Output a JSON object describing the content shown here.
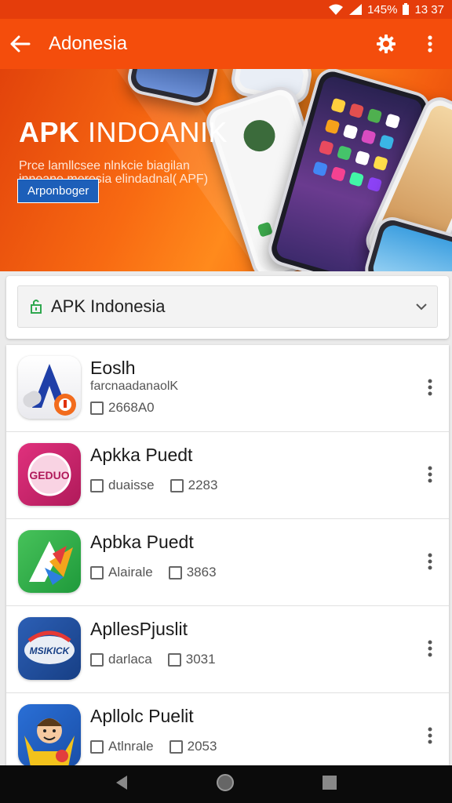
{
  "status_bar": {
    "battery": "145%",
    "time": "13 37"
  },
  "app_bar": {
    "title": "Adonesia"
  },
  "banner": {
    "title_bold": "APK ",
    "title_thin": "INDOANIK",
    "subtitle": "Prce lamllcsee nlnkcie biagilan inneane merosia elindadnal( APF)",
    "button": "Arponboger"
  },
  "selector": {
    "label": "APK Indonesia"
  },
  "apps": [
    {
      "name": "Eoslh",
      "sub": "farcnaadanaolK",
      "meta1": "2668A0",
      "meta2": ""
    },
    {
      "name": "Apkka Puedt",
      "sub": "",
      "meta1": "duaisse",
      "meta2": "2283"
    },
    {
      "name": "Apbka Puedt",
      "sub": "",
      "meta1": "Alairale",
      "meta2": "3863"
    },
    {
      "name": "ApllesPjuslit",
      "sub": "",
      "meta1": "darlaca",
      "meta2": "3031"
    },
    {
      "name": "Apllolc Puelit",
      "sub": "",
      "meta1": "Atlnrale",
      "meta2": "2053"
    }
  ],
  "icon_texts": {
    "app2": "GEDUO",
    "app4": "MSIKICK"
  },
  "colors": {
    "accent": "#f44d0c",
    "status": "#e53d0b",
    "nav": "#0b0b0b"
  }
}
